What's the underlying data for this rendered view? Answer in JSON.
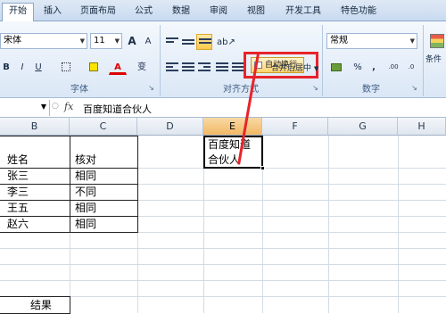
{
  "ribbon_tabs": [
    "开始",
    "插入",
    "页面布局",
    "公式",
    "数据",
    "审阅",
    "视图",
    "开发工具",
    "特色功能"
  ],
  "font": {
    "name": "宋体",
    "size": "11",
    "grow": "A",
    "shrink": "A"
  },
  "font_buttons": {
    "bold": "B",
    "italic": "I",
    "underline": "U",
    "font_color": "A",
    "phonetic": "变"
  },
  "alignment": {
    "wrap_text": "自动换行",
    "merge_center": "合并后居中"
  },
  "number": {
    "format": "常规",
    "percent": "%",
    "comma": ",",
    "inc_decimal": ".00",
    "dec_decimal": ".0"
  },
  "styles": {
    "conditional": "条件格"
  },
  "group_labels": {
    "font": "字体",
    "alignment": "对齐方式",
    "number": "数字"
  },
  "formula_bar": {
    "fx": "fx",
    "content": "百度知道合伙人"
  },
  "columns": [
    "B",
    "C",
    "D",
    "E",
    "F",
    "G",
    "H"
  ],
  "table": {
    "header": [
      "姓名",
      "核对"
    ],
    "rows": [
      [
        "张三",
        "相同"
      ],
      [
        "李三",
        "不同"
      ],
      [
        "王五",
        "相同"
      ],
      [
        "赵六",
        "相同"
      ]
    ]
  },
  "e_cell": {
    "line1": "百度知道",
    "line2": "合伙人"
  },
  "result_label": "结果",
  "colors": {
    "highlight": "#e8232a",
    "selected_col": "#f1b864"
  }
}
